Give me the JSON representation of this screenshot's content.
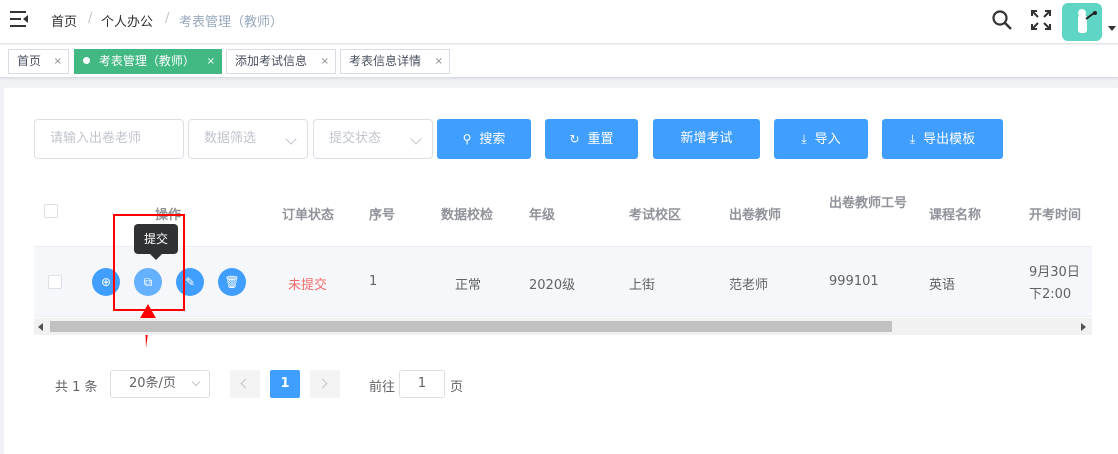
{
  "header": {
    "breadcrumb": [
      "首页",
      "个人办公",
      "考表管理（教师）"
    ],
    "separator": "/"
  },
  "tags": [
    {
      "label": "首页",
      "close": "×"
    },
    {
      "label": "考表管理（教师）",
      "close": "×"
    },
    {
      "label": "添加考试信息",
      "close": "×"
    },
    {
      "label": "考表信息详情",
      "close": "×"
    }
  ],
  "filters": {
    "teacher_placeholder": "请输入出卷老师",
    "data_filter_placeholder": "数据筛选",
    "submit_status_placeholder": "提交状态"
  },
  "buttons": {
    "search": "搜索",
    "reset": "重置",
    "add_exam": "新增考试",
    "import": "导入",
    "export_template": "导出模板"
  },
  "table": {
    "columns": [
      "操作",
      "订单状态",
      "序号",
      "数据校检",
      "年级",
      "考试校区",
      "出卷教师",
      "出卷教师工号",
      "课程名称",
      "开考时间"
    ],
    "rows": [
      {
        "order_status": "未提交",
        "index": "1",
        "data_check": "正常",
        "grade": "2020级",
        "campus": "上街",
        "teacher": "范老师",
        "teacher_id": "999101",
        "course": "英语",
        "start_time": "9月30日下2:00"
      }
    ],
    "tooltip": "提交",
    "status_color": "#f56c6c"
  },
  "pagination": {
    "total": "共 1 条",
    "page_size": "20条/页",
    "current_page": "1",
    "goto_label": "前往",
    "goto_value": "1",
    "page_unit": "页"
  },
  "colors": {
    "primary": "#409eff",
    "active_tag": "#42b983",
    "annotation": "#ff0000"
  }
}
